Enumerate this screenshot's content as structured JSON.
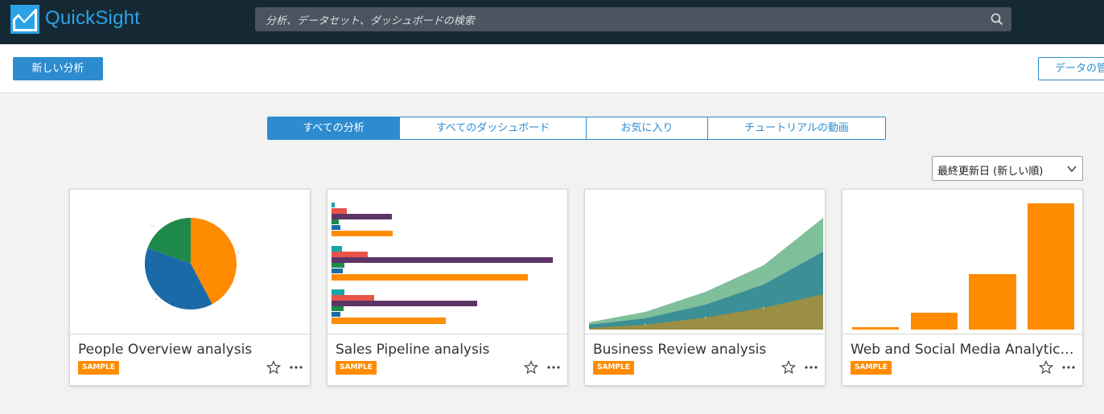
{
  "header": {
    "app_name": "QuickSight",
    "search_placeholder": "分析、データセット、ダッシュボードの検索"
  },
  "actions": {
    "new_analysis": "新しい分析",
    "manage_data": "データの管理"
  },
  "tabs": [
    {
      "label": "すべての分析",
      "active": true
    },
    {
      "label": "すべてのダッシュボード",
      "active": false
    },
    {
      "label": "お気に入り",
      "active": false
    },
    {
      "label": "チュートリアルの動画",
      "active": false
    }
  ],
  "sort": {
    "selected": "最終更新日 (新しい順)"
  },
  "cards": [
    {
      "title": "People Overview analysis",
      "badge": "SAMPLE",
      "thumbnail": "pie-chart"
    },
    {
      "title": "Sales Pipeline analysis",
      "badge": "SAMPLE",
      "thumbnail": "horizontal-bar-chart"
    },
    {
      "title": "Business Review analysis",
      "badge": "SAMPLE",
      "thumbnail": "area-chart"
    },
    {
      "title": "Web and Social Media Analytics analysis",
      "badge": "SAMPLE",
      "thumbnail": "bar-chart"
    }
  ],
  "colors": {
    "topbar": "#152935",
    "accent": "#2d8ccf",
    "logo": "#2aa3e5",
    "badge": "#ff8c00",
    "orange": "#ff8c00",
    "blue": "#1a6aa8",
    "green": "#1d8a4a",
    "purple": "#5c3566",
    "red": "#e8534a",
    "teal": "#17a5a8"
  }
}
